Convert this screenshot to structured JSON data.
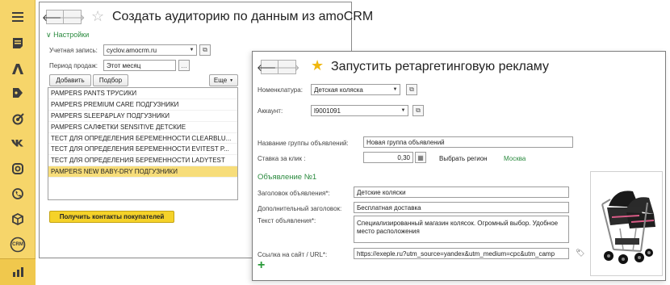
{
  "sidebar": {
    "icons": [
      "menu-icon",
      "document-icon",
      "amocrm-icon",
      "tag-icon",
      "target-icon",
      "vk-icon",
      "instagram-icon",
      "phone-icon",
      "box-icon",
      "crm-icon",
      "chart-icon"
    ],
    "crm_label": "CRM"
  },
  "window1": {
    "title": "Создать аудиторию по данным  из amoCRM",
    "settings_header": "Настройки",
    "account_label": "Учетная запись:",
    "account_value": "cyclov.amocrm.ru",
    "period_label": "Период продаж:",
    "period_value": "Этот месяц",
    "add_button": "Добавить",
    "pick_button": "Подбор",
    "more_button": "Еще",
    "list": [
      "PAMPERS PANTS ТРУСИКИ",
      "PAMPERS PREMIUM CARE ПОДГУЗНИКИ",
      "PAMPERS SLEEP&PLAY ПОДГУЗНИКИ",
      "PAMPERS САЛФЕТКИ SENSITIVE ДЕТСКИЕ",
      "ТЕСТ ДЛЯ ОПРЕДЕЛЕНИЯ БЕРЕМЕННОСТИ CLEARBLU...",
      "ТЕСТ ДЛЯ ОПРЕДЕЛЕНИЯ БЕРЕМЕННОСТИ EVITEST P...",
      "ТЕСТ ДЛЯ ОПРЕДЕЛЕНИЯ БЕРЕМЕННОСТИ LADYTEST",
      "PAMPERS NEW BABY-DRY ПОДГУЗНИКИ"
    ],
    "selected_index": 7,
    "get_contacts_button": "Получить контакты покупателей"
  },
  "window2": {
    "title": "Запустить ретаргетинговую рекламу",
    "nomenclature_label": "Номенклатура:",
    "nomenclature_value": "Детская коляска",
    "account_label": "Аккаунт:",
    "account_value": "l9001091",
    "group_name_label": "Название группы объявлений:",
    "group_name_value": "Новая группа объявлений",
    "bid_label": "Ставка за клик :",
    "bid_value": "0,30",
    "region_button": "Выбрать регион",
    "region_value": "Москва",
    "ad_header": "Объявление №1",
    "headline_label": "Заголовок объявления*:",
    "headline_value": "Детские коляски",
    "extra_headline_label": "Дополнительный заголовок:",
    "extra_headline_value": "Бесплатная доставка",
    "text_label": "Текст объявления*:",
    "text_value": "Специализированный магазин колясок. Огромный выбор. Удобное место расположения",
    "url_label": "Ссылка на сайт / URL*:",
    "url_value": "https://exeple.ru?utm_source=yandex&utm_medium=cpc&utm_camp",
    "add_symbol": "+"
  },
  "colors": {
    "sidebar": "#f6d56a",
    "accent_green": "#2a8a3e",
    "selected_row": "#f7dd7a",
    "star": "#f0b70f",
    "primary_button": "#f5d229"
  }
}
